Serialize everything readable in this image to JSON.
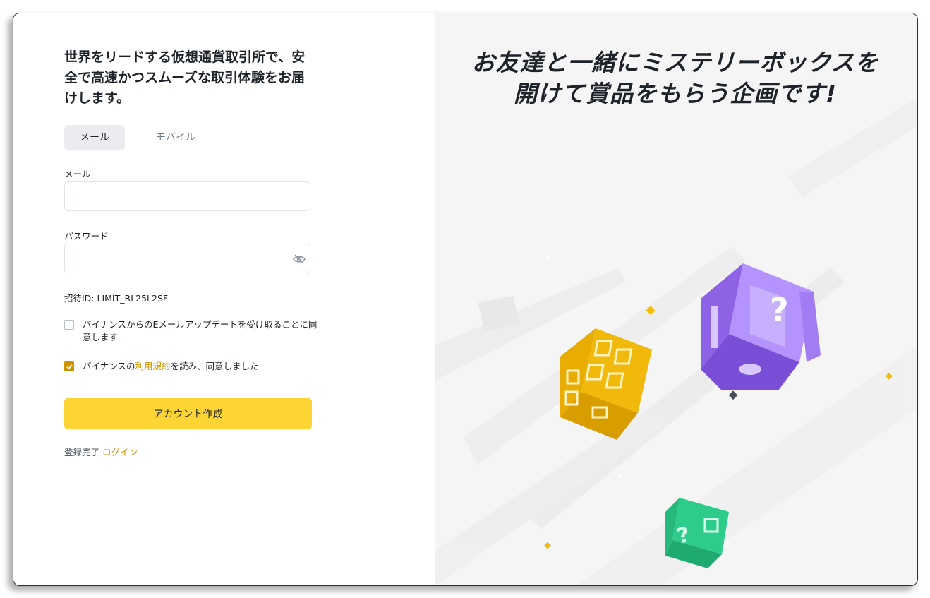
{
  "signup": {
    "headline": "世界をリードする仮想通貨取引所で、安全で高速かつスムーズな取引体験をお届けします。",
    "tabs": [
      {
        "label": "メール",
        "active": true
      },
      {
        "label": "モバイル",
        "active": false
      }
    ],
    "email": {
      "label": "メール",
      "value": "",
      "placeholder": ""
    },
    "password": {
      "label": "パスワード",
      "value": "",
      "placeholder": "",
      "visibility_icon": "eye-slash-icon"
    },
    "invite_id": "招待ID: LIMIT_RL25L2SF",
    "newsletter_checkbox": {
      "checked": false,
      "text": "バイナンスからのEメールアップデートを受け取ることに同意します"
    },
    "terms_checkbox": {
      "checked": true,
      "prefix": "バイナンスの",
      "link": "利用規約",
      "suffix": "を読み、同意しました"
    },
    "submit_label": "アカウント作成",
    "login_prompt": "登録完了",
    "login_link": "ログイン"
  },
  "promo": {
    "title_line1": "お友達と一緒にミステリーボックスを",
    "title_line2": "開けて賞品をもらう企画です!",
    "boxes": [
      "yellow-mystery-box",
      "purple-mystery-box",
      "green-mystery-box"
    ]
  },
  "colors": {
    "accent": "#fcd535",
    "link": "#c99400",
    "text": "#1e2329",
    "right_panel_bg": "#f5f5f5",
    "purple_box": "#a27cf2",
    "yellow_box": "#f0b90b",
    "green_box": "#2ecc8b"
  }
}
